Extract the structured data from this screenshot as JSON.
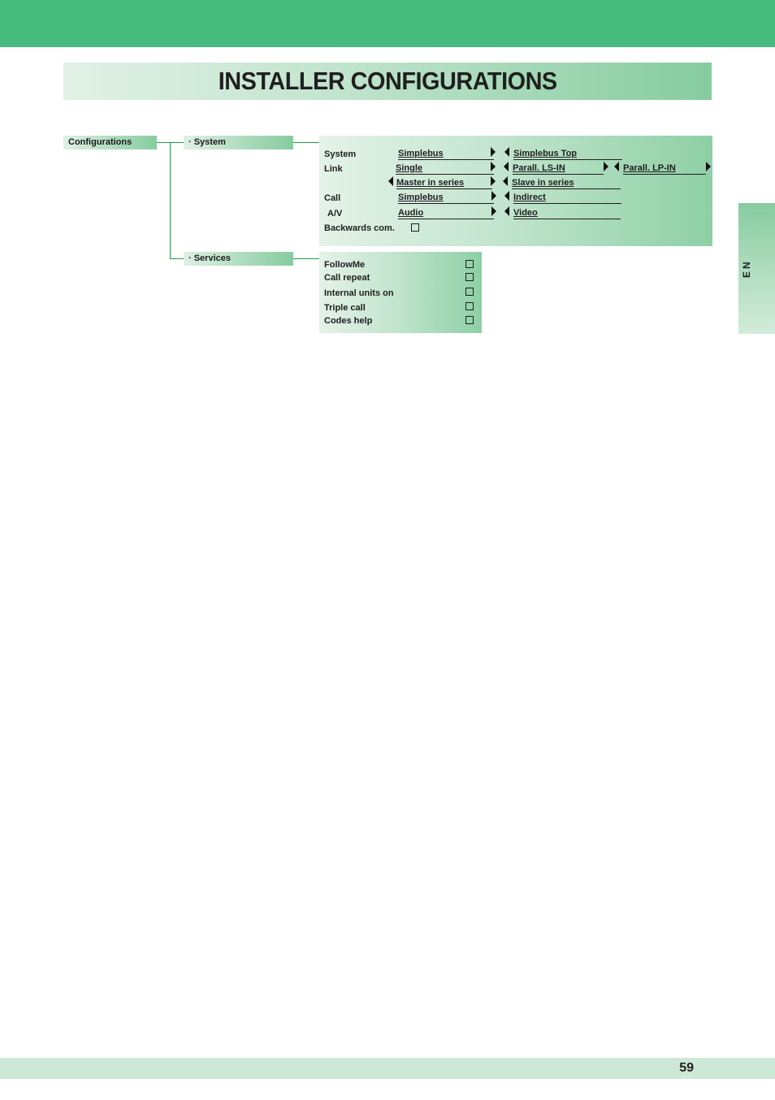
{
  "page": {
    "title": "INSTALLER CONFIGURATIONS",
    "language_tab": "EN",
    "page_number": "59"
  },
  "tree": {
    "root": "Configurations",
    "system_node": "· System",
    "services_node": "· Services"
  },
  "system_panel": {
    "rows": [
      {
        "label": "System",
        "options": [
          "Simplebus",
          "Simplebus Top"
        ]
      },
      {
        "label": "Link",
        "options": [
          "Single",
          "Parall. LS-IN",
          "Parall. LP-IN"
        ]
      },
      {
        "label": "",
        "options": [
          "Master in series",
          "Slave in series"
        ]
      },
      {
        "label": "Call",
        "options": [
          "Simplebus",
          "Indirect"
        ]
      },
      {
        "label": "A/V",
        "options": [
          "Audio",
          "Video"
        ]
      },
      {
        "label": "Backwards com.",
        "checkbox": true
      }
    ]
  },
  "services_panel": {
    "items": [
      {
        "label": "FollowMe",
        "checked": false
      },
      {
        "label": "Call repeat",
        "checked": false
      },
      {
        "label": "Internal units on",
        "checked": false
      },
      {
        "label": "Triple call",
        "checked": false
      },
      {
        "label": "Codes help",
        "checked": false
      }
    ]
  },
  "colors": {
    "brand_green": "#45bb7e",
    "connector_green": "#1e9a50",
    "footer_band": "#cde8d6"
  }
}
